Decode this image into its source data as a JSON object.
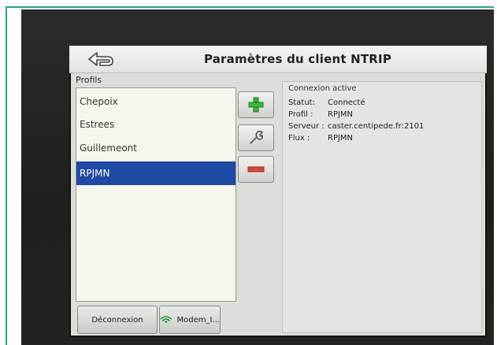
{
  "window": {
    "title": "Paramètres du client NTRIP"
  },
  "profiles": {
    "label": "Profils",
    "items": [
      {
        "label": "Chepoix",
        "selected": false
      },
      {
        "label": "Estrees",
        "selected": false
      },
      {
        "label": "Guillemeont",
        "selected": false
      },
      {
        "label": "RPJMN",
        "selected": true
      }
    ]
  },
  "actions": {
    "add_icon": "plus-icon",
    "edit_icon": "wrench-icon",
    "remove_icon": "minus-icon"
  },
  "bottom": {
    "disconnect_label": "Déconnexion",
    "modem_label": "Modem_I..."
  },
  "connection": {
    "title": "Connexion active",
    "rows": [
      {
        "key": "Statut:",
        "value": "Connecté"
      },
      {
        "key": "Profil :",
        "value": "RPJMN"
      },
      {
        "key": "Serveur :",
        "value": "caster.centipede.fr:2101"
      },
      {
        "key": "Flux :",
        "value": "RPJMN"
      }
    ]
  },
  "colors": {
    "selection": "#1f4aa3",
    "add": "#3db43d",
    "remove": "#d9453c",
    "wifi": "#1e9a3a"
  }
}
